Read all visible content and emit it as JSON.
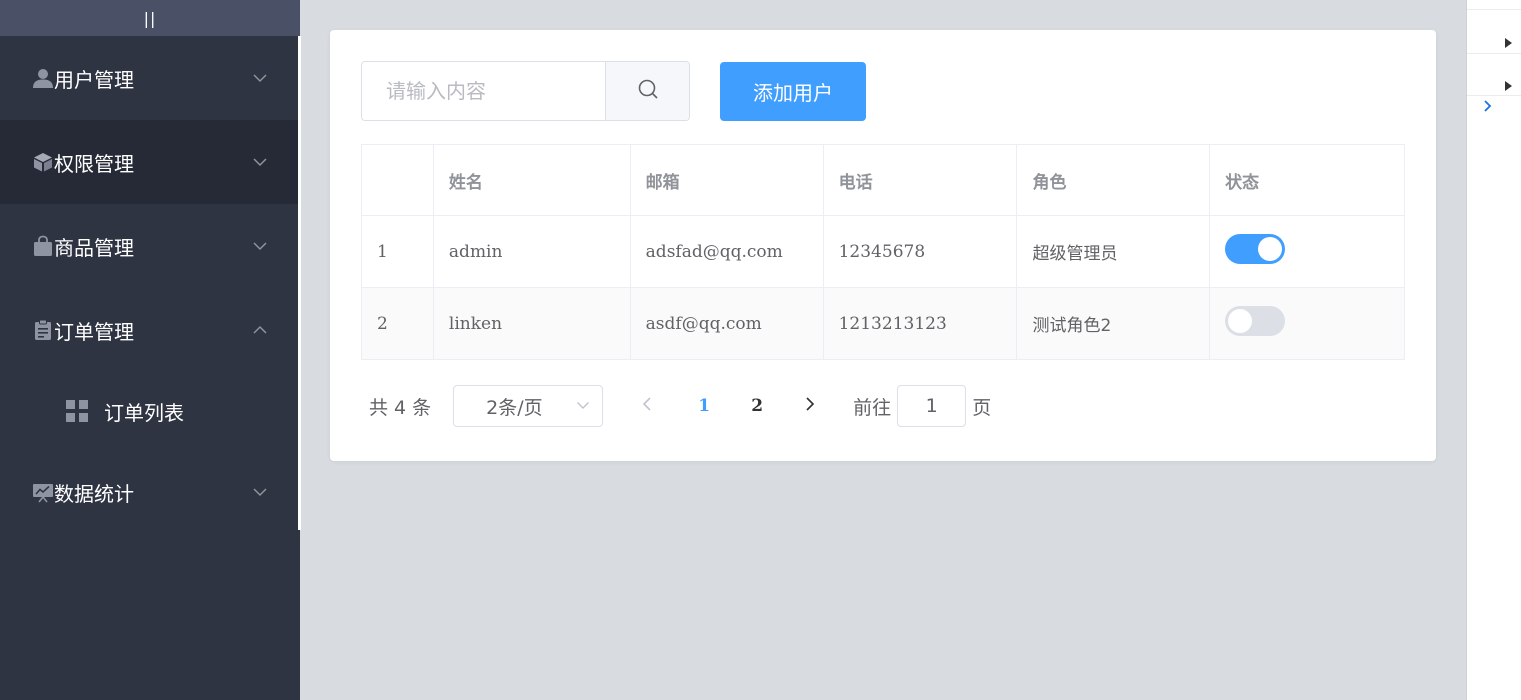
{
  "sidebar": {
    "toggle_label": "||",
    "items": [
      {
        "label": "用户管理",
        "icon": "user-icon"
      },
      {
        "label": "权限管理",
        "icon": "box-icon"
      },
      {
        "label": "商品管理",
        "icon": "bag-icon"
      },
      {
        "label": "订单管理",
        "icon": "clipboard-icon",
        "children": [
          {
            "label": "订单列表",
            "icon": "grid-icon"
          }
        ]
      },
      {
        "label": "数据统计",
        "icon": "chart-icon"
      }
    ]
  },
  "toolbar": {
    "search_placeholder": "请输入内容",
    "search_value": "",
    "add_label": "添加用户"
  },
  "table": {
    "columns": [
      "",
      "姓名",
      "邮箱",
      "电话",
      "角色",
      "状态"
    ],
    "rows": [
      {
        "index": "1",
        "name": "admin",
        "email": "adsfad@qq.com",
        "phone": "12345678",
        "role": "超级管理员",
        "state": true
      },
      {
        "index": "2",
        "name": "linken",
        "email": "asdf@qq.com",
        "phone": "1213213123",
        "role": "测试角色2",
        "state": false
      }
    ]
  },
  "pagination": {
    "total_text": "共 4 条",
    "page_size_text": "2条/页",
    "pages": [
      "1",
      "2"
    ],
    "current_page": "1",
    "goto_label": "前往",
    "goto_value": "1",
    "goto_suffix": "页"
  },
  "colors": {
    "sidebar_bg": "#2f3443",
    "sidebar_active_bg": "#262a36",
    "primary": "#409eff",
    "page_bg": "#d8dbe0"
  }
}
